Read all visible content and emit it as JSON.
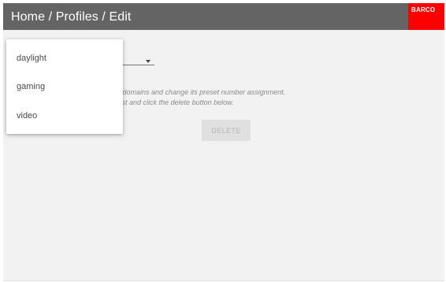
{
  "header": {
    "breadcrumb": "Home / Profiles / Edit",
    "logo_text": "BARCO",
    "background": "#646464",
    "logo_background": "#ff0000"
  },
  "dropdown": {
    "items": [
      {
        "label": "daylight"
      },
      {
        "label": "gaming"
      },
      {
        "label": "video"
      }
    ]
  },
  "content": {
    "info_line1": "ee the domains and change its preset number assignment.",
    "info_line2": "n the list and click the delete button below."
  },
  "actions": {
    "delete_label": "DELETE"
  }
}
